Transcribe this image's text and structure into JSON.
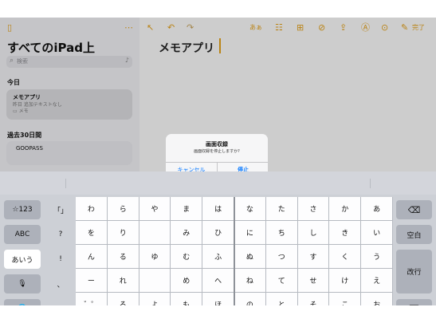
{
  "toolbar": {
    "sidebar_icon": "▯",
    "more_icon": "⋯",
    "expand_icon": "↖",
    "undo_icon": "↶",
    "redo_icon": "↷",
    "format_label": "あぁ",
    "checklist_icon": "☷",
    "table_icon": "⊞",
    "attach_icon": "⊘",
    "share_icon": "⇪",
    "markup_icon": "Ⓐ",
    "more2_icon": "⊙",
    "compose_icon": "✎",
    "done_label": "完了"
  },
  "sidebar": {
    "title": "すべてのiPad上",
    "search_placeholder": "検索",
    "section_today": "今日",
    "notes_today": [
      {
        "title": "メモアプリ",
        "preview": "昨日  追加テキストなし",
        "folder": "メモ"
      }
    ],
    "section_30days": "過去30日間",
    "notes_30days": [
      {
        "title": "GOOPASS"
      }
    ]
  },
  "note": {
    "title": "メモアプリ"
  },
  "alert": {
    "title": "画面収録",
    "message": "画面収録を停止しますか?",
    "cancel": "キャンセル",
    "stop": "停止"
  },
  "keyboard": {
    "left_keys": [
      "☆123",
      "ABC",
      "あいう",
      "🎙",
      "🌐"
    ],
    "punct_col": [
      "「」",
      "?",
      "!",
      "、",
      "。"
    ],
    "rows": [
      [
        "わ",
        "ら",
        "や",
        "ま",
        "は",
        "な",
        "た",
        "さ",
        "か",
        "あ"
      ],
      [
        "を",
        "り",
        "",
        "み",
        "ひ",
        "に",
        "ち",
        "し",
        "き",
        "い"
      ],
      [
        "ん",
        "る",
        "ゆ",
        "む",
        "ふ",
        "ぬ",
        "つ",
        "す",
        "く",
        "う"
      ],
      [
        "ー",
        "れ",
        "",
        "め",
        "へ",
        "ね",
        "て",
        "せ",
        "け",
        "え"
      ],
      [
        "゛゜",
        "ろ",
        "よ",
        "も",
        "ほ",
        "の",
        "と",
        "そ",
        "こ",
        "お"
      ]
    ],
    "delete_icon": "⌫",
    "space_label": "空白",
    "return_label": "改行",
    "dismiss_icon": "⌨"
  }
}
